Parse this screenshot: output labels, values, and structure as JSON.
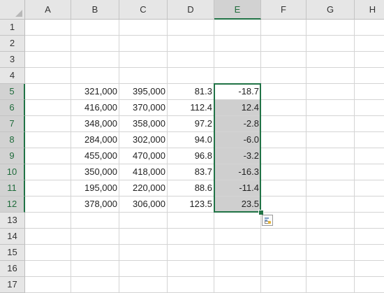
{
  "columns": [
    "A",
    "B",
    "C",
    "D",
    "E",
    "F",
    "G",
    "H"
  ],
  "rows": [
    "1",
    "2",
    "3",
    "4",
    "5",
    "6",
    "7",
    "8",
    "9",
    "10",
    "11",
    "12",
    "13",
    "14",
    "15",
    "16",
    "17"
  ],
  "active_column": "E",
  "selection": {
    "range": "E5:E12"
  },
  "table": [
    {
      "row": "5",
      "B": "321,000",
      "C": "395,000",
      "D": "81.3",
      "E": "-18.7"
    },
    {
      "row": "6",
      "B": "416,000",
      "C": "370,000",
      "D": "112.4",
      "E": "12.4"
    },
    {
      "row": "7",
      "B": "348,000",
      "C": "358,000",
      "D": "97.2",
      "E": "-2.8"
    },
    {
      "row": "8",
      "B": "284,000",
      "C": "302,000",
      "D": "94.0",
      "E": "-6.0"
    },
    {
      "row": "9",
      "B": "455,000",
      "C": "470,000",
      "D": "96.8",
      "E": "-3.2"
    },
    {
      "row": "10",
      "B": "350,000",
      "C": "418,000",
      "D": "83.7",
      "E": "-16.3"
    },
    {
      "row": "11",
      "B": "195,000",
      "C": "220,000",
      "D": "88.6",
      "E": "-11.4"
    },
    {
      "row": "12",
      "B": "378,000",
      "C": "306,000",
      "D": "123.5",
      "E": "23.5"
    }
  ],
  "icons": {
    "select_all": "select-all-triangle-icon",
    "quick_analysis": "quick-analysis-icon"
  },
  "colors": {
    "selection_border": "#217346",
    "selection_fill": "#cfcfcf",
    "header_bg": "#e6e6e6",
    "gridline": "#d4d4d4"
  }
}
